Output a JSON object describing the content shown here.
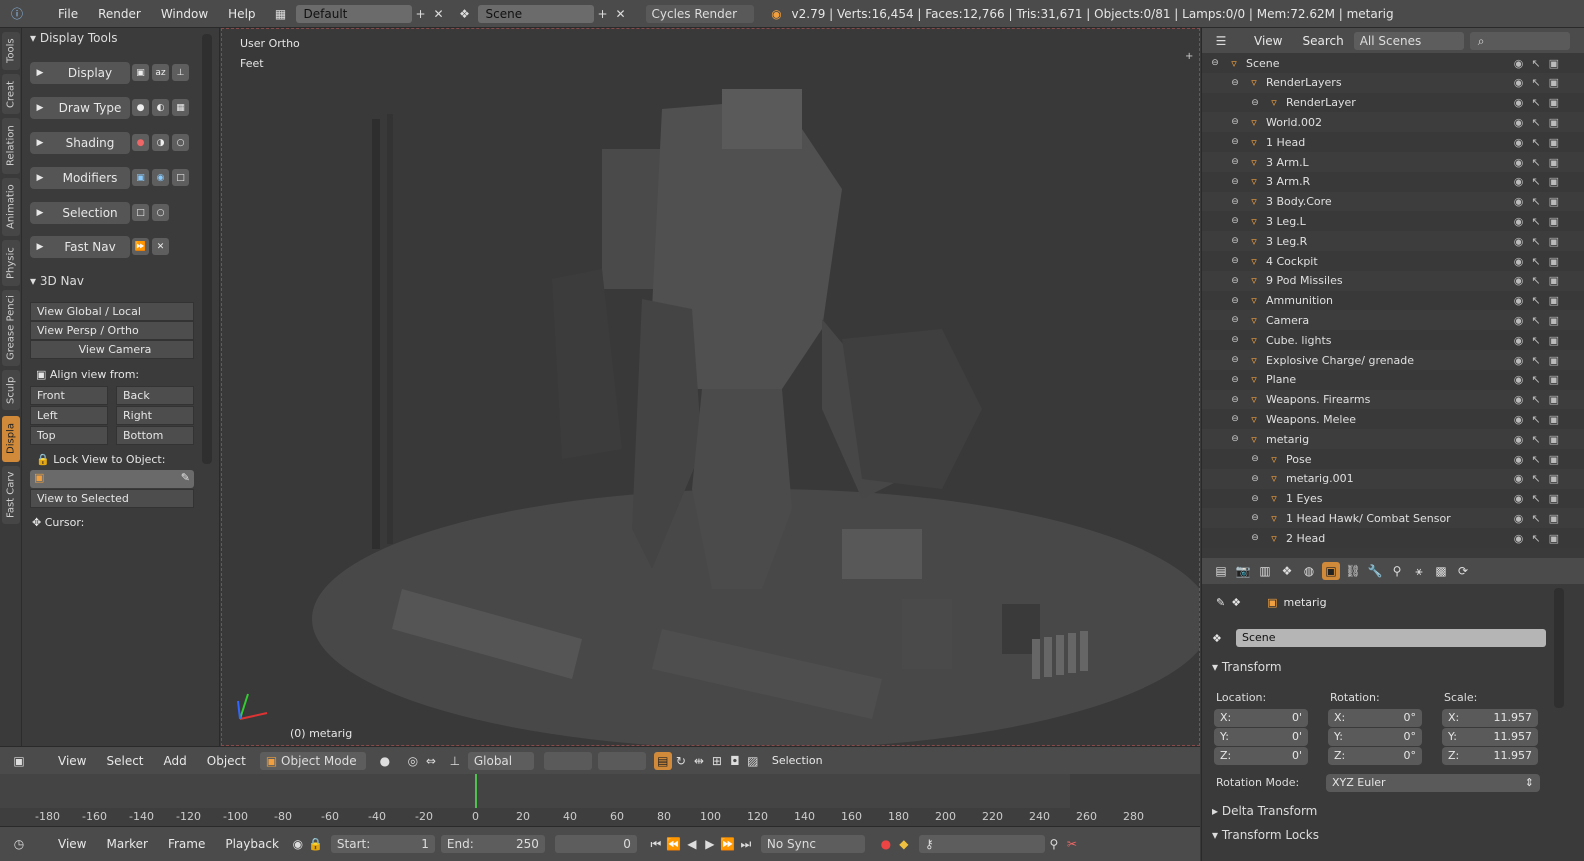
{
  "topbar": {
    "menus": [
      "File",
      "Render",
      "Window",
      "Help"
    ],
    "layout": "Default",
    "scene": "Scene",
    "engine": "Cycles Render",
    "stats": "v2.79 | Verts:16,454 | Faces:12,766 | Tris:31,671 | Objects:0/81 | Lamps:0/0 | Mem:72.62M | metarig"
  },
  "tabs": [
    "Tools",
    "Creat",
    "Relation",
    "Animatio",
    "Physic",
    "Grease Penci",
    "Sculp",
    "Displa",
    "Fast Carv"
  ],
  "shelf": {
    "display_tools": "Display Tools",
    "rows": [
      "Display",
      "Draw Type",
      "Shading",
      "Modifiers",
      "Selection",
      "Fast Nav"
    ],
    "nav3d": "3D Nav",
    "view_global": "View Global / Local",
    "view_persp": "View Persp / Ortho",
    "view_camera": "View Camera",
    "align_label": "Align view from:",
    "front": "Front",
    "back": "Back",
    "left": "Left",
    "right": "Right",
    "top": "Top",
    "bottom": "Bottom",
    "lock_label": "Lock View to Object:",
    "view_selected": "View to Selected",
    "cursor": "Cursor:"
  },
  "viewport": {
    "view_name": "User Ortho",
    "units": "Feet",
    "object_label": "(0) metarig"
  },
  "vpheader": {
    "view": "View",
    "select": "Select",
    "add": "Add",
    "object": "Object",
    "mode": "Object Mode",
    "orientation": "Global",
    "selection": "Selection"
  },
  "timeline": {
    "ticks": [
      "-180",
      "-160",
      "-140",
      "-120",
      "-100",
      "-80",
      "-60",
      "-40",
      "-20",
      "0",
      "20",
      "40",
      "60",
      "80",
      "100",
      "120",
      "140",
      "160",
      "180",
      "200",
      "220",
      "240",
      "260",
      "280"
    ],
    "view": "View",
    "marker": "Marker",
    "frame": "Frame",
    "playback": "Playback",
    "start_label": "Start:",
    "start": "1",
    "end_label": "End:",
    "end": "250",
    "current": "0",
    "sync": "No Sync"
  },
  "outliner": {
    "view": "View",
    "search": "Search",
    "filter": "All Scenes",
    "items": [
      {
        "name": "Scene",
        "indent": 0
      },
      {
        "name": "RenderLayers",
        "indent": 1
      },
      {
        "name": "RenderLayer",
        "indent": 2
      },
      {
        "name": "World.002",
        "indent": 1
      },
      {
        "name": "1 Head",
        "indent": 1
      },
      {
        "name": "3 Arm.L",
        "indent": 1
      },
      {
        "name": "3 Arm.R",
        "indent": 1
      },
      {
        "name": "3 Body.Core",
        "indent": 1
      },
      {
        "name": "3 Leg.L",
        "indent": 1
      },
      {
        "name": "3 Leg.R",
        "indent": 1
      },
      {
        "name": "4 Cockpit",
        "indent": 1
      },
      {
        "name": "9 Pod Missiles",
        "indent": 1
      },
      {
        "name": "Ammunition",
        "indent": 1
      },
      {
        "name": "Camera",
        "indent": 1
      },
      {
        "name": "Cube. lights",
        "indent": 1
      },
      {
        "name": "Explosive Charge/ grenade",
        "indent": 1
      },
      {
        "name": "Plane",
        "indent": 1
      },
      {
        "name": "Weapons. Firearms",
        "indent": 1
      },
      {
        "name": "Weapons. Melee",
        "indent": 1
      },
      {
        "name": "metarig",
        "indent": 1
      },
      {
        "name": "Pose",
        "indent": 2
      },
      {
        "name": "metarig.001",
        "indent": 2
      },
      {
        "name": "1 Eyes",
        "indent": 2
      },
      {
        "name": "1 Head Hawk/ Combat Sensor",
        "indent": 2
      },
      {
        "name": "2 Head",
        "indent": 2
      }
    ]
  },
  "props": {
    "object": "metarig",
    "scene": "Scene",
    "transform": "Transform",
    "location": "Location:",
    "rotation": "Rotation:",
    "scale": "Scale:",
    "loc": [
      "X:",
      "0'",
      "Y:",
      "0'",
      "Z:",
      "0'"
    ],
    "rot": [
      "X:",
      "0°",
      "Y:",
      "0°",
      "Z:",
      "0°"
    ],
    "scl": [
      "X:",
      "11.957",
      "Y:",
      "11.957",
      "Z:",
      "11.957"
    ],
    "rotation_mode": "Rotation Mode:",
    "rotation_mode_value": "XYZ Euler",
    "delta": "Delta Transform",
    "locks": "Transform Locks"
  }
}
